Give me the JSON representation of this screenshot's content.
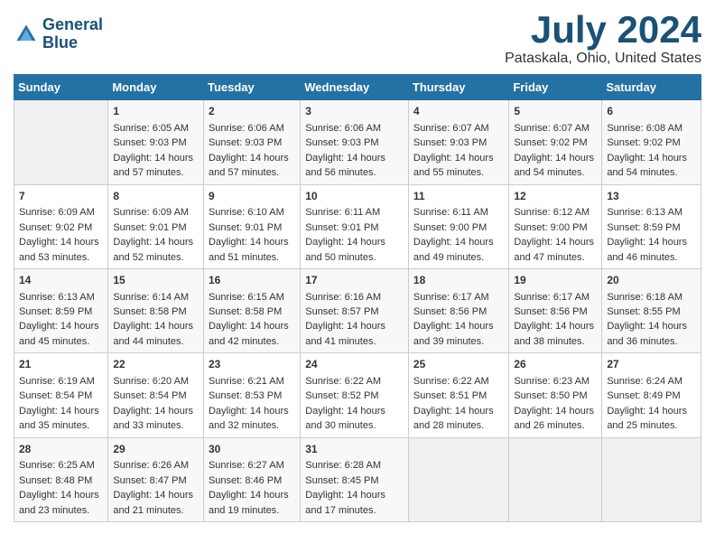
{
  "logo": {
    "line1": "General",
    "line2": "Blue"
  },
  "title": "July 2024",
  "subtitle": "Pataskala, Ohio, United States",
  "days_header": [
    "Sunday",
    "Monday",
    "Tuesday",
    "Wednesday",
    "Thursday",
    "Friday",
    "Saturday"
  ],
  "weeks": [
    [
      {
        "day": "",
        "sunrise": "",
        "sunset": "",
        "daylight": ""
      },
      {
        "day": "1",
        "sunrise": "Sunrise: 6:05 AM",
        "sunset": "Sunset: 9:03 PM",
        "daylight": "Daylight: 14 hours and 57 minutes."
      },
      {
        "day": "2",
        "sunrise": "Sunrise: 6:06 AM",
        "sunset": "Sunset: 9:03 PM",
        "daylight": "Daylight: 14 hours and 57 minutes."
      },
      {
        "day": "3",
        "sunrise": "Sunrise: 6:06 AM",
        "sunset": "Sunset: 9:03 PM",
        "daylight": "Daylight: 14 hours and 56 minutes."
      },
      {
        "day": "4",
        "sunrise": "Sunrise: 6:07 AM",
        "sunset": "Sunset: 9:03 PM",
        "daylight": "Daylight: 14 hours and 55 minutes."
      },
      {
        "day": "5",
        "sunrise": "Sunrise: 6:07 AM",
        "sunset": "Sunset: 9:02 PM",
        "daylight": "Daylight: 14 hours and 54 minutes."
      },
      {
        "day": "6",
        "sunrise": "Sunrise: 6:08 AM",
        "sunset": "Sunset: 9:02 PM",
        "daylight": "Daylight: 14 hours and 54 minutes."
      }
    ],
    [
      {
        "day": "7",
        "sunrise": "Sunrise: 6:09 AM",
        "sunset": "Sunset: 9:02 PM",
        "daylight": "Daylight: 14 hours and 53 minutes."
      },
      {
        "day": "8",
        "sunrise": "Sunrise: 6:09 AM",
        "sunset": "Sunset: 9:01 PM",
        "daylight": "Daylight: 14 hours and 52 minutes."
      },
      {
        "day": "9",
        "sunrise": "Sunrise: 6:10 AM",
        "sunset": "Sunset: 9:01 PM",
        "daylight": "Daylight: 14 hours and 51 minutes."
      },
      {
        "day": "10",
        "sunrise": "Sunrise: 6:11 AM",
        "sunset": "Sunset: 9:01 PM",
        "daylight": "Daylight: 14 hours and 50 minutes."
      },
      {
        "day": "11",
        "sunrise": "Sunrise: 6:11 AM",
        "sunset": "Sunset: 9:00 PM",
        "daylight": "Daylight: 14 hours and 49 minutes."
      },
      {
        "day": "12",
        "sunrise": "Sunrise: 6:12 AM",
        "sunset": "Sunset: 9:00 PM",
        "daylight": "Daylight: 14 hours and 47 minutes."
      },
      {
        "day": "13",
        "sunrise": "Sunrise: 6:13 AM",
        "sunset": "Sunset: 8:59 PM",
        "daylight": "Daylight: 14 hours and 46 minutes."
      }
    ],
    [
      {
        "day": "14",
        "sunrise": "Sunrise: 6:13 AM",
        "sunset": "Sunset: 8:59 PM",
        "daylight": "Daylight: 14 hours and 45 minutes."
      },
      {
        "day": "15",
        "sunrise": "Sunrise: 6:14 AM",
        "sunset": "Sunset: 8:58 PM",
        "daylight": "Daylight: 14 hours and 44 minutes."
      },
      {
        "day": "16",
        "sunrise": "Sunrise: 6:15 AM",
        "sunset": "Sunset: 8:58 PM",
        "daylight": "Daylight: 14 hours and 42 minutes."
      },
      {
        "day": "17",
        "sunrise": "Sunrise: 6:16 AM",
        "sunset": "Sunset: 8:57 PM",
        "daylight": "Daylight: 14 hours and 41 minutes."
      },
      {
        "day": "18",
        "sunrise": "Sunrise: 6:17 AM",
        "sunset": "Sunset: 8:56 PM",
        "daylight": "Daylight: 14 hours and 39 minutes."
      },
      {
        "day": "19",
        "sunrise": "Sunrise: 6:17 AM",
        "sunset": "Sunset: 8:56 PM",
        "daylight": "Daylight: 14 hours and 38 minutes."
      },
      {
        "day": "20",
        "sunrise": "Sunrise: 6:18 AM",
        "sunset": "Sunset: 8:55 PM",
        "daylight": "Daylight: 14 hours and 36 minutes."
      }
    ],
    [
      {
        "day": "21",
        "sunrise": "Sunrise: 6:19 AM",
        "sunset": "Sunset: 8:54 PM",
        "daylight": "Daylight: 14 hours and 35 minutes."
      },
      {
        "day": "22",
        "sunrise": "Sunrise: 6:20 AM",
        "sunset": "Sunset: 8:54 PM",
        "daylight": "Daylight: 14 hours and 33 minutes."
      },
      {
        "day": "23",
        "sunrise": "Sunrise: 6:21 AM",
        "sunset": "Sunset: 8:53 PM",
        "daylight": "Daylight: 14 hours and 32 minutes."
      },
      {
        "day": "24",
        "sunrise": "Sunrise: 6:22 AM",
        "sunset": "Sunset: 8:52 PM",
        "daylight": "Daylight: 14 hours and 30 minutes."
      },
      {
        "day": "25",
        "sunrise": "Sunrise: 6:22 AM",
        "sunset": "Sunset: 8:51 PM",
        "daylight": "Daylight: 14 hours and 28 minutes."
      },
      {
        "day": "26",
        "sunrise": "Sunrise: 6:23 AM",
        "sunset": "Sunset: 8:50 PM",
        "daylight": "Daylight: 14 hours and 26 minutes."
      },
      {
        "day": "27",
        "sunrise": "Sunrise: 6:24 AM",
        "sunset": "Sunset: 8:49 PM",
        "daylight": "Daylight: 14 hours and 25 minutes."
      }
    ],
    [
      {
        "day": "28",
        "sunrise": "Sunrise: 6:25 AM",
        "sunset": "Sunset: 8:48 PM",
        "daylight": "Daylight: 14 hours and 23 minutes."
      },
      {
        "day": "29",
        "sunrise": "Sunrise: 6:26 AM",
        "sunset": "Sunset: 8:47 PM",
        "daylight": "Daylight: 14 hours and 21 minutes."
      },
      {
        "day": "30",
        "sunrise": "Sunrise: 6:27 AM",
        "sunset": "Sunset: 8:46 PM",
        "daylight": "Daylight: 14 hours and 19 minutes."
      },
      {
        "day": "31",
        "sunrise": "Sunrise: 6:28 AM",
        "sunset": "Sunset: 8:45 PM",
        "daylight": "Daylight: 14 hours and 17 minutes."
      },
      {
        "day": "",
        "sunrise": "",
        "sunset": "",
        "daylight": ""
      },
      {
        "day": "",
        "sunrise": "",
        "sunset": "",
        "daylight": ""
      },
      {
        "day": "",
        "sunrise": "",
        "sunset": "",
        "daylight": ""
      }
    ]
  ]
}
